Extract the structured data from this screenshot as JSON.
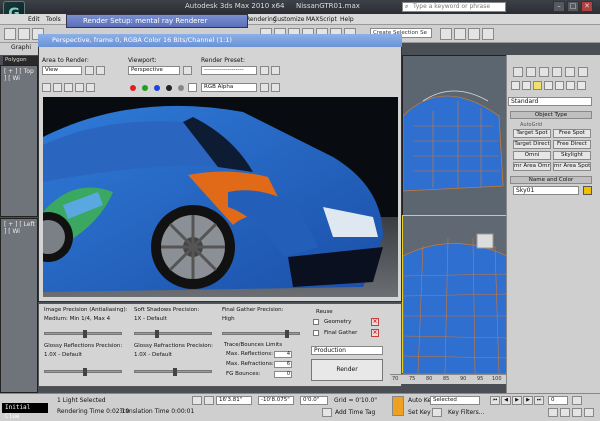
{
  "app": {
    "title_prefix": "Autodesk 3ds Max  2010 x64",
    "title_file": "NissanGTR01.max",
    "logo_text": "G",
    "search_placeholder": "Type a keyword or phrase",
    "win_min": "–",
    "win_max": "□",
    "win_close": "✕"
  },
  "menu": {
    "items": [
      "Edit",
      "Tools",
      "Rendering",
      "Customize",
      "MAXScript",
      "Help"
    ]
  },
  "toolbar": {
    "selection_set_placeholder": "Create Selection Se"
  },
  "ribbon": {
    "graphite_tab": "Graphi",
    "polygon_tab": "Polygon Mod"
  },
  "viewports": {
    "top_label": "[ + ] [ Top ] [ Wi",
    "left_label": "[ + ] [ Left ] [ Wi"
  },
  "render_setup": {
    "title": "Render Setup: mental ray Renderer"
  },
  "frame_window": {
    "title": "Perspective, frame 0, RGBA Color 16 Bits/Channel (1:1)",
    "area_label": "Area to Render:",
    "area_value": "View",
    "viewport_label": "Viewport:",
    "viewport_value": "Perspective",
    "preset_label": "Render Preset:",
    "preset_value": "--------------------",
    "channel_value": "RGB Alpha"
  },
  "render_panel": {
    "image_precision_label": "Image Precision (Antialiasing):",
    "image_precision_value": "Medium: Min 1/4, Max 4",
    "soft_shadows_label": "Soft Shadows Precision:",
    "soft_shadows_value": "1X - Default",
    "final_gather_label": "Final Gather Precision:",
    "final_gather_value": "High",
    "glossy_reflections_label": "Glossy Reflections Precision:",
    "glossy_reflections_value": "1.0X - Default",
    "glossy_refractions_label": "Glossy Refractions Precision:",
    "glossy_refractions_value": "1.0X - Default",
    "trace_label": "Trace/Bounces Limits",
    "max_reflections_label": "Max. Reflections:",
    "max_reflections_value": "4",
    "max_refractions_label": "Max. Refractions:",
    "max_refractions_value": "6",
    "fg_bounces_label": "FG Bounces:",
    "fg_bounces_value": "0",
    "reuse_label": "Reuse",
    "geometry_label": "Geometry",
    "final_gather_check_label": "Final Gather",
    "production_value": "Production",
    "render_button": "Render"
  },
  "command_panel": {
    "standard_value": "Standard",
    "object_type_label": "Object Type",
    "autogrid_label": "AutoGrid",
    "buttons": [
      "Target Spot",
      "Free Spot",
      "Target Direct",
      "Free Direct",
      "Omni",
      "Skylight",
      "mr Area Omni",
      "mr Area Spot"
    ],
    "name_color_label": "Name and Color",
    "name_value": "Sky01",
    "swatch_color": "#f0c000"
  },
  "timeline": {
    "ticks": [
      "70",
      "75",
      "80",
      "85",
      "90",
      "95",
      "100"
    ]
  },
  "status": {
    "maxscript_text": "Initial Clue",
    "selected_text": "1 Light Selected",
    "rendering_time": "Rendering Time  0:02:19",
    "translation_time": "Translation Time  0:00:01",
    "x_value": "16'3.81\"",
    "y_value": "-10'8.075\"",
    "z_value": "0'0.0\"",
    "grid_text": "Grid = 0'10.0\"",
    "add_time_tag": "Add Time Tag",
    "auto_key": "Auto Key",
    "selected_dropdown": "Selected",
    "set_key": "Set Key",
    "key_filters": "Key Filters...",
    "frame_value": "0"
  }
}
